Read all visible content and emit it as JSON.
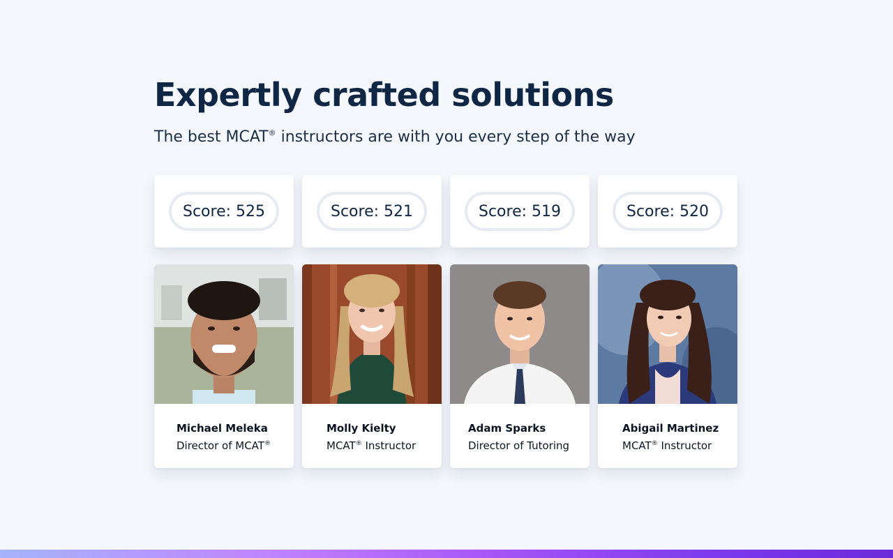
{
  "header": {
    "title": "Expertly crafted solutions",
    "subtitle_before": "The best MCAT",
    "subtitle_reg": "®",
    "subtitle_after": " instructors are with you every step of the way"
  },
  "scores": [
    {
      "label": "Score: 525"
    },
    {
      "label": "Score: 521"
    },
    {
      "label": "Score: 519"
    },
    {
      "label": "Score: 520"
    }
  ],
  "instructors": [
    {
      "name": "Michael Meleka",
      "role": "Director of MCAT",
      "role_reg": "®",
      "role_after": ""
    },
    {
      "name": "Molly Kielty",
      "role": "MCAT",
      "role_reg": "®",
      "role_after": " Instructor"
    },
    {
      "name": "Adam Sparks",
      "role": "Director of Tutoring",
      "role_reg": "",
      "role_after": ""
    },
    {
      "name": "Abigail Martinez",
      "role": "MCAT",
      "role_reg": "®",
      "role_after": " Instructor"
    }
  ],
  "colors": {
    "background": "#f4f7fb",
    "heading": "#0f2744",
    "pill_border": "#e6eaf2",
    "bar_start": "#a5b4fc",
    "bar_end": "#6d28d9"
  }
}
